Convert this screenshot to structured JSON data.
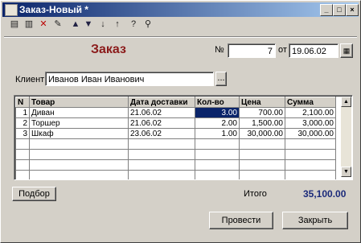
{
  "window": {
    "title": "Заказ-Новый *",
    "controls": [
      "_",
      "□",
      "×"
    ]
  },
  "toolbar": {
    "icons": [
      "new-doc-icon",
      "copy-doc-icon",
      "delete-doc-icon",
      "edit-doc-icon",
      "move-up-icon",
      "move-down-icon",
      "sort-asc-icon",
      "sort-desc-icon",
      "help-icon",
      "filter-icon"
    ]
  },
  "header": {
    "title": "Заказ",
    "number_label": "№",
    "number_value": "7",
    "date_label": "от",
    "date_value": "19.06.02"
  },
  "client": {
    "label": "Клиент:",
    "value": "Иванов Иван Иванович",
    "select_button": "..."
  },
  "table": {
    "columns": [
      "N",
      "Товар",
      "Дата доставки",
      "Кол-во",
      "Цена",
      "Сумма"
    ],
    "rows": [
      [
        "1",
        "Диван",
        "21.06.02",
        "3.00",
        "700.00",
        "2,100.00"
      ],
      [
        "2",
        "Торшер",
        "21.06.02",
        "2.00",
        "1,500.00",
        "3,000.00"
      ],
      [
        "3",
        "Шкаф",
        "23.06.02",
        "1.00",
        "30,000.00",
        "30,000.00"
      ]
    ]
  },
  "footer": {
    "pick_button": "Подбор",
    "total_label": "Итого",
    "total_value": "35,100.00",
    "post_button": "Провести",
    "close_button": "Закрыть"
  }
}
